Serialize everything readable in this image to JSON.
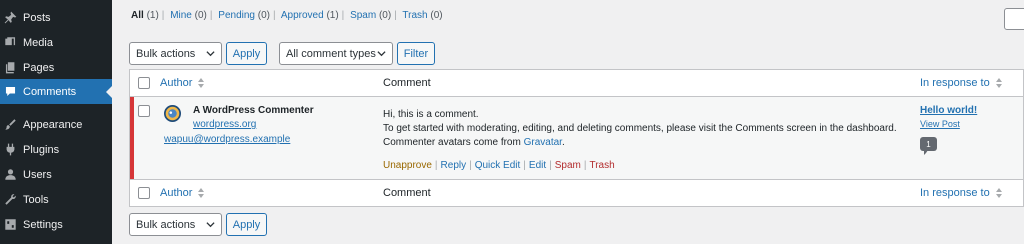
{
  "sidebar": {
    "items": [
      {
        "label": "Posts",
        "icon": "pushpin-icon",
        "current": false
      },
      {
        "label": "Media",
        "icon": "media-icon",
        "current": false
      },
      {
        "label": "Pages",
        "icon": "pages-icon",
        "current": false
      },
      {
        "label": "Comments",
        "icon": "comment-icon",
        "current": true
      },
      {
        "label": "Appearance",
        "icon": "paintbrush-icon",
        "current": false
      },
      {
        "label": "Plugins",
        "icon": "plugin-icon",
        "current": false
      },
      {
        "label": "Users",
        "icon": "users-icon",
        "current": false
      },
      {
        "label": "Tools",
        "icon": "wrench-icon",
        "current": false
      },
      {
        "label": "Settings",
        "icon": "settings-icon",
        "current": false
      }
    ]
  },
  "filters": [
    {
      "label": "All",
      "count": "(1)"
    },
    {
      "label": "Mine",
      "count": "(0)"
    },
    {
      "label": "Pending",
      "count": "(0)"
    },
    {
      "label": "Approved",
      "count": "(1)"
    },
    {
      "label": "Spam",
      "count": "(0)"
    },
    {
      "label": "Trash",
      "count": "(0)"
    }
  ],
  "tablenav_top": {
    "bulk_actions": "Bulk actions",
    "apply": "Apply",
    "comment_types": "All comment types",
    "filter": "Filter"
  },
  "tablenav_bottom": {
    "bulk_actions": "Bulk actions",
    "apply": "Apply"
  },
  "columns": {
    "author": "Author",
    "comment": "Comment",
    "response": "In response to"
  },
  "comment": {
    "author_name": "A WordPress Commenter",
    "author_url": "wordpress.org",
    "author_email": "wapuu@wordpress.example",
    "line1": "Hi, this is a comment.",
    "line2": "To get started with moderating, editing, and deleting comments, please visit the Comments screen in the dashboard.",
    "line3_prefix": "Commenter avatars come from ",
    "line3_link": "Gravatar",
    "line3_suffix": ".",
    "actions": {
      "unapprove": "Unapprove",
      "reply": "Reply",
      "quick_edit": "Quick Edit",
      "edit": "Edit",
      "spam": "Spam",
      "trash": "Trash"
    },
    "response_title": "Hello world!",
    "response_view": "View Post",
    "response_count": "1"
  },
  "colors": {
    "accent": "#2271b1",
    "sidebar_bg": "#1d2327",
    "unapprove": "#996800",
    "danger": "#b32d2e"
  }
}
